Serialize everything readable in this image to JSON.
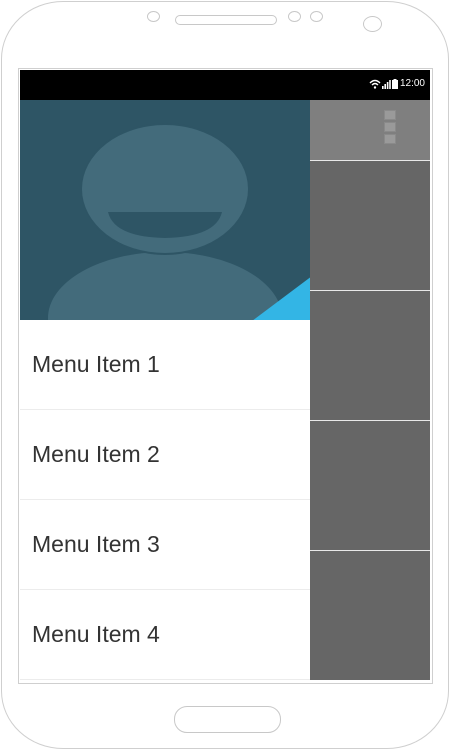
{
  "status_bar": {
    "time": "12:00"
  },
  "menu": {
    "items": [
      {
        "label": "Menu Item 1"
      },
      {
        "label": "Menu Item 2"
      },
      {
        "label": "Menu Item 3"
      },
      {
        "label": "Menu Item 4"
      }
    ]
  },
  "colors": {
    "header_bg": "#2e5565",
    "avatar": "#436b7b",
    "accent": "#33b5e5",
    "appbar": "#7f7f7f",
    "content_bg": "#666666"
  }
}
